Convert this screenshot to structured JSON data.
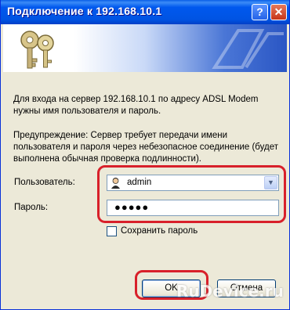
{
  "window": {
    "title": "Подключение к 192.168.10.1",
    "help_glyph": "?",
    "close_glyph": "✕"
  },
  "banner": {
    "icon": "keys-icon"
  },
  "message": {
    "description": "Для входа на сервер 192.168.10.1 по адресу ADSL Modem нужны имя пользователя и пароль.",
    "warning": "Предупреждение: Сервер требует передачи имени пользователя и пароля через небезопасное соединение (будет выполнена обычная проверка подлинности)."
  },
  "form": {
    "username_label": "Пользователь:",
    "username_value": "admin",
    "password_label": "Пароль:",
    "password_value": "●●●●●",
    "remember_label": "Сохранить пароль",
    "remember_checked": false
  },
  "buttons": {
    "ok_label": "OK",
    "cancel_label": "Отмена"
  },
  "watermark": "RuDevice.ru",
  "colors": {
    "title_bar": "#0054e3",
    "dialog_bg": "#ece9d8",
    "highlight": "#d8202a"
  }
}
